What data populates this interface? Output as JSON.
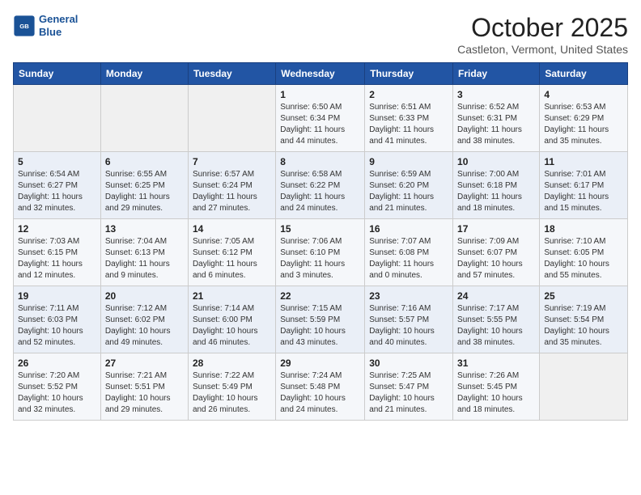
{
  "header": {
    "logo_line1": "General",
    "logo_line2": "Blue",
    "month": "October 2025",
    "location": "Castleton, Vermont, United States"
  },
  "weekdays": [
    "Sunday",
    "Monday",
    "Tuesday",
    "Wednesday",
    "Thursday",
    "Friday",
    "Saturday"
  ],
  "weeks": [
    [
      {
        "day": "",
        "sunrise": "",
        "sunset": "",
        "daylight": ""
      },
      {
        "day": "",
        "sunrise": "",
        "sunset": "",
        "daylight": ""
      },
      {
        "day": "",
        "sunrise": "",
        "sunset": "",
        "daylight": ""
      },
      {
        "day": "1",
        "sunrise": "Sunrise: 6:50 AM",
        "sunset": "Sunset: 6:34 PM",
        "daylight": "Daylight: 11 hours and 44 minutes."
      },
      {
        "day": "2",
        "sunrise": "Sunrise: 6:51 AM",
        "sunset": "Sunset: 6:33 PM",
        "daylight": "Daylight: 11 hours and 41 minutes."
      },
      {
        "day": "3",
        "sunrise": "Sunrise: 6:52 AM",
        "sunset": "Sunset: 6:31 PM",
        "daylight": "Daylight: 11 hours and 38 minutes."
      },
      {
        "day": "4",
        "sunrise": "Sunrise: 6:53 AM",
        "sunset": "Sunset: 6:29 PM",
        "daylight": "Daylight: 11 hours and 35 minutes."
      }
    ],
    [
      {
        "day": "5",
        "sunrise": "Sunrise: 6:54 AM",
        "sunset": "Sunset: 6:27 PM",
        "daylight": "Daylight: 11 hours and 32 minutes."
      },
      {
        "day": "6",
        "sunrise": "Sunrise: 6:55 AM",
        "sunset": "Sunset: 6:25 PM",
        "daylight": "Daylight: 11 hours and 29 minutes."
      },
      {
        "day": "7",
        "sunrise": "Sunrise: 6:57 AM",
        "sunset": "Sunset: 6:24 PM",
        "daylight": "Daylight: 11 hours and 27 minutes."
      },
      {
        "day": "8",
        "sunrise": "Sunrise: 6:58 AM",
        "sunset": "Sunset: 6:22 PM",
        "daylight": "Daylight: 11 hours and 24 minutes."
      },
      {
        "day": "9",
        "sunrise": "Sunrise: 6:59 AM",
        "sunset": "Sunset: 6:20 PM",
        "daylight": "Daylight: 11 hours and 21 minutes."
      },
      {
        "day": "10",
        "sunrise": "Sunrise: 7:00 AM",
        "sunset": "Sunset: 6:18 PM",
        "daylight": "Daylight: 11 hours and 18 minutes."
      },
      {
        "day": "11",
        "sunrise": "Sunrise: 7:01 AM",
        "sunset": "Sunset: 6:17 PM",
        "daylight": "Daylight: 11 hours and 15 minutes."
      }
    ],
    [
      {
        "day": "12",
        "sunrise": "Sunrise: 7:03 AM",
        "sunset": "Sunset: 6:15 PM",
        "daylight": "Daylight: 11 hours and 12 minutes."
      },
      {
        "day": "13",
        "sunrise": "Sunrise: 7:04 AM",
        "sunset": "Sunset: 6:13 PM",
        "daylight": "Daylight: 11 hours and 9 minutes."
      },
      {
        "day": "14",
        "sunrise": "Sunrise: 7:05 AM",
        "sunset": "Sunset: 6:12 PM",
        "daylight": "Daylight: 11 hours and 6 minutes."
      },
      {
        "day": "15",
        "sunrise": "Sunrise: 7:06 AM",
        "sunset": "Sunset: 6:10 PM",
        "daylight": "Daylight: 11 hours and 3 minutes."
      },
      {
        "day": "16",
        "sunrise": "Sunrise: 7:07 AM",
        "sunset": "Sunset: 6:08 PM",
        "daylight": "Daylight: 11 hours and 0 minutes."
      },
      {
        "day": "17",
        "sunrise": "Sunrise: 7:09 AM",
        "sunset": "Sunset: 6:07 PM",
        "daylight": "Daylight: 10 hours and 57 minutes."
      },
      {
        "day": "18",
        "sunrise": "Sunrise: 7:10 AM",
        "sunset": "Sunset: 6:05 PM",
        "daylight": "Daylight: 10 hours and 55 minutes."
      }
    ],
    [
      {
        "day": "19",
        "sunrise": "Sunrise: 7:11 AM",
        "sunset": "Sunset: 6:03 PM",
        "daylight": "Daylight: 10 hours and 52 minutes."
      },
      {
        "day": "20",
        "sunrise": "Sunrise: 7:12 AM",
        "sunset": "Sunset: 6:02 PM",
        "daylight": "Daylight: 10 hours and 49 minutes."
      },
      {
        "day": "21",
        "sunrise": "Sunrise: 7:14 AM",
        "sunset": "Sunset: 6:00 PM",
        "daylight": "Daylight: 10 hours and 46 minutes."
      },
      {
        "day": "22",
        "sunrise": "Sunrise: 7:15 AM",
        "sunset": "Sunset: 5:59 PM",
        "daylight": "Daylight: 10 hours and 43 minutes."
      },
      {
        "day": "23",
        "sunrise": "Sunrise: 7:16 AM",
        "sunset": "Sunset: 5:57 PM",
        "daylight": "Daylight: 10 hours and 40 minutes."
      },
      {
        "day": "24",
        "sunrise": "Sunrise: 7:17 AM",
        "sunset": "Sunset: 5:55 PM",
        "daylight": "Daylight: 10 hours and 38 minutes."
      },
      {
        "day": "25",
        "sunrise": "Sunrise: 7:19 AM",
        "sunset": "Sunset: 5:54 PM",
        "daylight": "Daylight: 10 hours and 35 minutes."
      }
    ],
    [
      {
        "day": "26",
        "sunrise": "Sunrise: 7:20 AM",
        "sunset": "Sunset: 5:52 PM",
        "daylight": "Daylight: 10 hours and 32 minutes."
      },
      {
        "day": "27",
        "sunrise": "Sunrise: 7:21 AM",
        "sunset": "Sunset: 5:51 PM",
        "daylight": "Daylight: 10 hours and 29 minutes."
      },
      {
        "day": "28",
        "sunrise": "Sunrise: 7:22 AM",
        "sunset": "Sunset: 5:49 PM",
        "daylight": "Daylight: 10 hours and 26 minutes."
      },
      {
        "day": "29",
        "sunrise": "Sunrise: 7:24 AM",
        "sunset": "Sunset: 5:48 PM",
        "daylight": "Daylight: 10 hours and 24 minutes."
      },
      {
        "day": "30",
        "sunrise": "Sunrise: 7:25 AM",
        "sunset": "Sunset: 5:47 PM",
        "daylight": "Daylight: 10 hours and 21 minutes."
      },
      {
        "day": "31",
        "sunrise": "Sunrise: 7:26 AM",
        "sunset": "Sunset: 5:45 PM",
        "daylight": "Daylight: 10 hours and 18 minutes."
      },
      {
        "day": "",
        "sunrise": "",
        "sunset": "",
        "daylight": ""
      }
    ]
  ]
}
